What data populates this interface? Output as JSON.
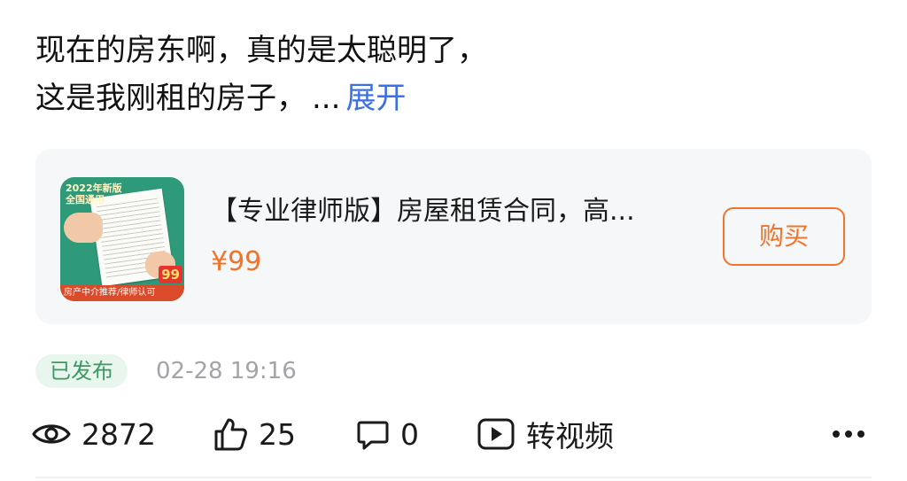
{
  "post": {
    "text_line1": "现在的房东啊，真的是太聪明了，",
    "text_line2": "这是我刚租的房子，",
    "ellipsis": "...",
    "expand_label": "展开"
  },
  "product": {
    "thumbnail": {
      "banner_line1": "2022年新版",
      "banner_line2": "全国通用",
      "price_tag": "99",
      "bottom_text": "房产中介推荐/律师认可"
    },
    "title": "【专业律师版】房屋租赁合同，高...",
    "price": "¥99",
    "buy_label": "购买",
    "accent_color": "#f0742a"
  },
  "meta": {
    "status": "已发布",
    "timestamp": "02-28 19:16"
  },
  "stats": {
    "views": "2872",
    "likes": "25",
    "comments": "0",
    "video_label": "转视频",
    "icons": [
      "eye-icon",
      "thumbs-up-icon",
      "comment-icon",
      "play-video-icon",
      "more-icon"
    ]
  }
}
